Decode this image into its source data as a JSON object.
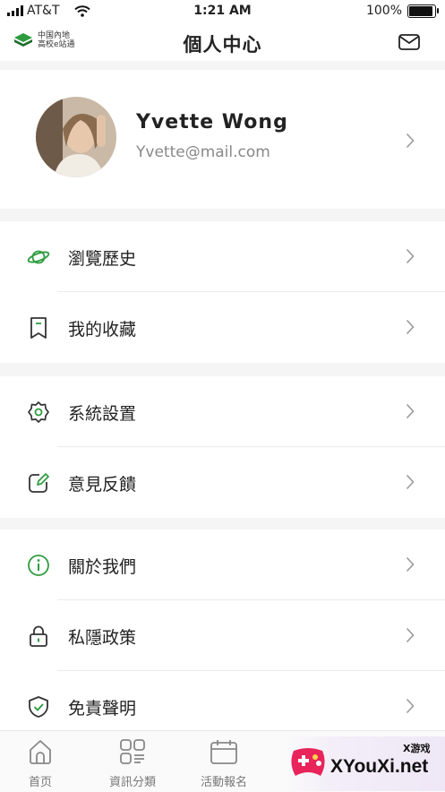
{
  "status_bar": {
    "carrier": "AT&T",
    "time": "1:21 AM",
    "battery": "100%"
  },
  "nav": {
    "logo_line1": "中国內地",
    "logo_line2": "高校e站通",
    "title": "個人中心"
  },
  "profile": {
    "name": "Yvette Wong",
    "email": "Yvette@mail.com"
  },
  "groups": [
    [
      {
        "label": "瀏覽歷史",
        "icon": "planet-icon"
      },
      {
        "label": "我的收藏",
        "icon": "bookmark-icon"
      }
    ],
    [
      {
        "label": "系統設置",
        "icon": "gear-icon"
      },
      {
        "label": "意見反饋",
        "icon": "edit-icon"
      }
    ],
    [
      {
        "label": "關於我們",
        "icon": "info-icon"
      },
      {
        "label": "私隱政策",
        "icon": "lock-icon"
      },
      {
        "label": "免責聲明",
        "icon": "shield-check-icon"
      }
    ]
  ],
  "tabs": [
    {
      "label": "首页",
      "icon": "home-icon"
    },
    {
      "label": "資訊分類",
      "icon": "category-icon"
    },
    {
      "label": "活動報名",
      "icon": "calendar-icon"
    }
  ],
  "watermark": {
    "small": "X游戏",
    "big": "XYouXi.net"
  },
  "colors": {
    "accent": "#2e9c3e",
    "text": "#222222",
    "muted": "#888888"
  }
}
